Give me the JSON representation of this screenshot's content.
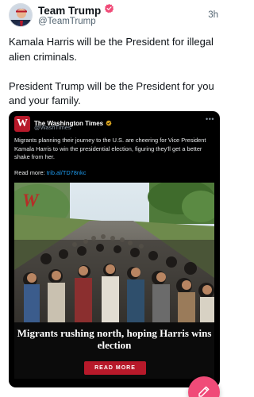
{
  "post": {
    "display_name": "Team Trump",
    "handle": "@TeamTrump",
    "timestamp": "3h",
    "verified_badge_color": "#f04b78",
    "text_paragraph_1": "Kamala Harris will be the President for illegal alien criminals.",
    "text_paragraph_2": "President Trump will be the President for you and your family."
  },
  "embed": {
    "logo_letter": "W",
    "account_name": "The Washington Times",
    "account_handle": "@WashTimes",
    "verified_badge_color": "#d9a420",
    "more_icon": "more-dots-icon",
    "text": "Migrants planning their journey to the U.S. are cheering for Vice President Kamala Harris to win the presidential election, figuring they'll get a better shake from her.",
    "read_more_label": "Read more:",
    "read_more_link": "trib.al/TD78nkc",
    "link_color": "#1d9bf0",
    "article": {
      "photo_logo": "W",
      "headline": "Migrants rushing north, hoping Harris wins election",
      "button_label": "READ MORE",
      "button_color": "#b7192a"
    }
  },
  "fab": {
    "icon": "compose-icon",
    "color": "#f04b78"
  }
}
